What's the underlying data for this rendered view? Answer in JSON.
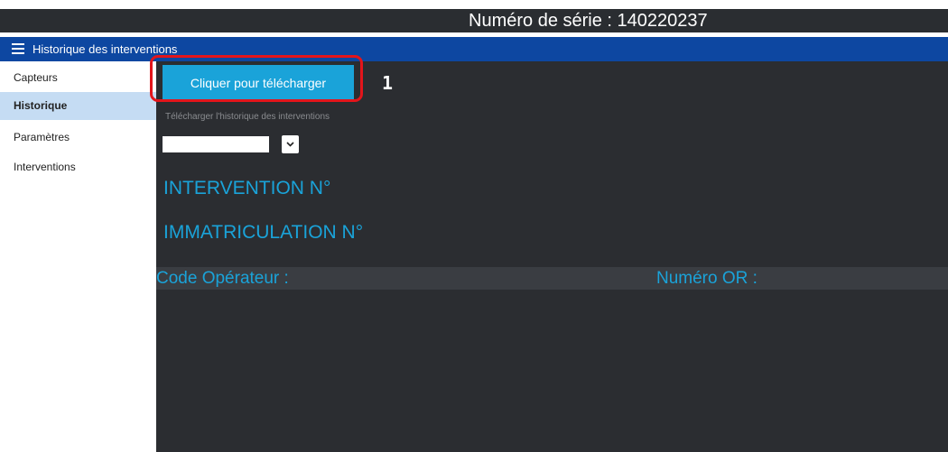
{
  "header": {
    "serial_text": "Numéro de série : 140220237"
  },
  "navbar": {
    "title": "Historique des interventions",
    "menu_icon": "hamburger-icon"
  },
  "sidebar": {
    "items": [
      {
        "label": "Capteurs",
        "active": false
      },
      {
        "label": "Historique",
        "active": true
      },
      {
        "label": "Paramètres",
        "active": false
      },
      {
        "label": "Interventions",
        "active": false
      }
    ]
  },
  "main": {
    "download_button": "Cliquer pour télécharger",
    "step_number": "1",
    "download_help": "Télécharger l'historique des interventions",
    "select": {
      "value": "",
      "icon": "chevron-down-icon"
    },
    "intervention_label": "INTERVENTION N°",
    "immatriculation_label": "IMMATRICULATION N°",
    "operator_label": "Code Opérateur :",
    "or_label": "Numéro OR :"
  },
  "colors": {
    "accent": "#1aa3d9",
    "nav": "#0d47a1",
    "background": "#2b2d31",
    "highlight": "#e3151b",
    "sidebar_active": "#c5dcf3"
  }
}
